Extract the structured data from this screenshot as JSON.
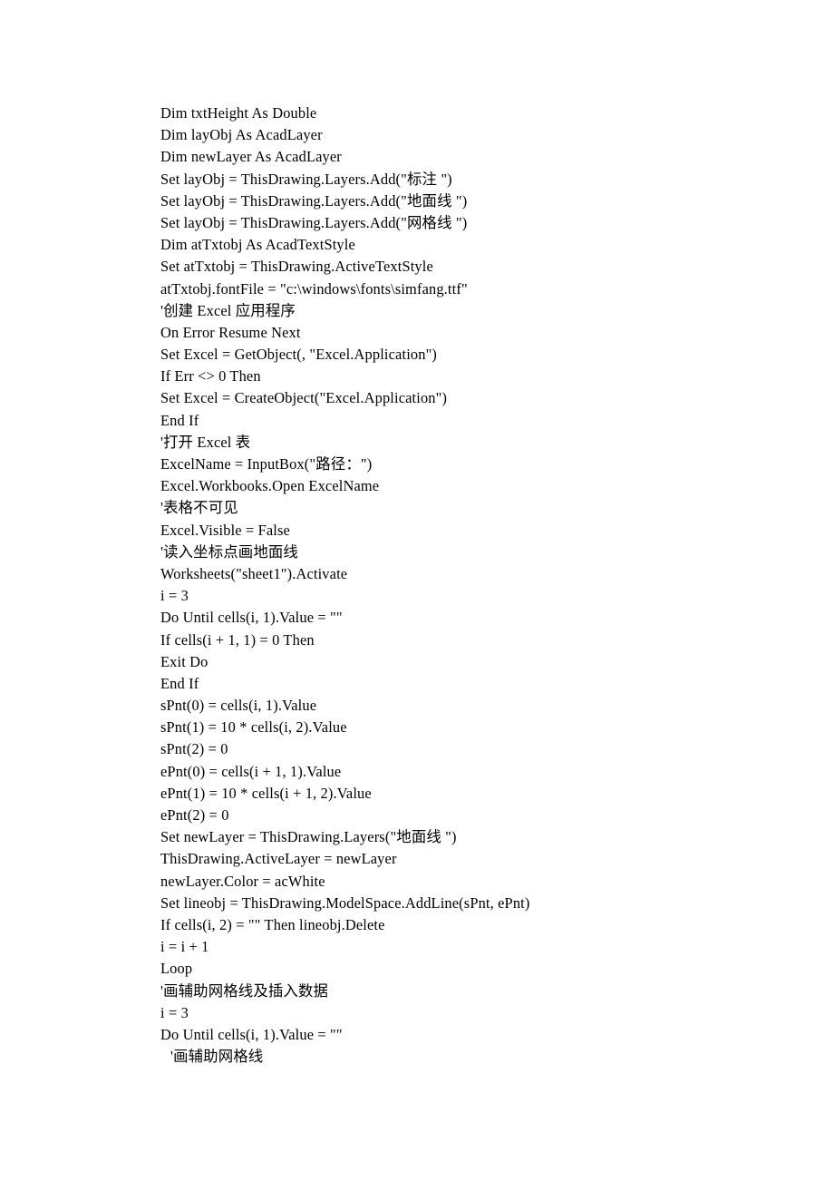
{
  "document": {
    "type": "code-listing",
    "language": "VBA (AutoCAD ActiveX)",
    "page_background": "#ffffff",
    "text_color": "#000000",
    "lines": [
      {
        "text": "Dim txtHeight As Double",
        "indent": 0
      },
      {
        "text": "Dim layObj As AcadLayer",
        "indent": 0
      },
      {
        "text": "Dim newLayer As AcadLayer",
        "indent": 0
      },
      {
        "text": "Set layObj = ThisDrawing.Layers.Add(\"标注 \")",
        "indent": 0
      },
      {
        "text": "Set layObj = ThisDrawing.Layers.Add(\"地面线 \")",
        "indent": 0
      },
      {
        "text": "Set layObj = ThisDrawing.Layers.Add(\"网格线 \")",
        "indent": 0
      },
      {
        "text": "Dim atTxtobj As AcadTextStyle",
        "indent": 0
      },
      {
        "text": "Set atTxtobj = ThisDrawing.ActiveTextStyle",
        "indent": 0
      },
      {
        "text": "atTxtobj.fontFile = \"c:\\windows\\fonts\\simfang.ttf\"",
        "indent": 0
      },
      {
        "text": "'创建 Excel 应用程序",
        "indent": 0
      },
      {
        "text": "On Error Resume Next",
        "indent": 0
      },
      {
        "text": "Set Excel = GetObject(, \"Excel.Application\")",
        "indent": 0
      },
      {
        "text": "If Err <> 0 Then",
        "indent": 0
      },
      {
        "text": "Set Excel = CreateObject(\"Excel.Application\")",
        "indent": 0
      },
      {
        "text": "End If",
        "indent": 0
      },
      {
        "text": "'打开 Excel 表",
        "indent": 0
      },
      {
        "text": "ExcelName = InputBox(\"路径：\")",
        "indent": 0
      },
      {
        "text": "Excel.Workbooks.Open ExcelName",
        "indent": 0
      },
      {
        "text": "'表格不可见",
        "indent": 0
      },
      {
        "text": "Excel.Visible = False",
        "indent": 0
      },
      {
        "text": "'读入坐标点画地面线",
        "indent": 0
      },
      {
        "text": "Worksheets(\"sheet1\").Activate",
        "indent": 0
      },
      {
        "text": "i = 3",
        "indent": 0
      },
      {
        "text": "Do Until cells(i, 1).Value = \"\"",
        "indent": 0
      },
      {
        "text": "If cells(i + 1, 1) = 0 Then",
        "indent": 0
      },
      {
        "text": "Exit Do",
        "indent": 0
      },
      {
        "text": "End If",
        "indent": 0
      },
      {
        "text": "sPnt(0) = cells(i, 1).Value",
        "indent": 0
      },
      {
        "text": "sPnt(1) = 10 * cells(i, 2).Value",
        "indent": 0
      },
      {
        "text": "sPnt(2) = 0",
        "indent": 0
      },
      {
        "text": "ePnt(0) = cells(i + 1, 1).Value",
        "indent": 0
      },
      {
        "text": "ePnt(1) = 10 * cells(i + 1, 2).Value",
        "indent": 0
      },
      {
        "text": "ePnt(2) = 0",
        "indent": 0
      },
      {
        "text": "Set newLayer = ThisDrawing.Layers(\"地面线 \")",
        "indent": 0
      },
      {
        "text": "ThisDrawing.ActiveLayer = newLayer",
        "indent": 0
      },
      {
        "text": "newLayer.Color = acWhite",
        "indent": 0
      },
      {
        "text": "Set lineobj = ThisDrawing.ModelSpace.AddLine(sPnt, ePnt)",
        "indent": 0
      },
      {
        "text": "If cells(i, 2) = \"\" Then lineobj.Delete",
        "indent": 0
      },
      {
        "text": "i = i + 1",
        "indent": 0
      },
      {
        "text": "Loop",
        "indent": 0
      },
      {
        "text": "'画辅助网格线及插入数据",
        "indent": 0
      },
      {
        "text": "i = 3",
        "indent": 0
      },
      {
        "text": "Do Until cells(i, 1).Value = \"\"",
        "indent": 0
      },
      {
        "text": "'画辅助网格线",
        "indent": 1
      }
    ]
  }
}
